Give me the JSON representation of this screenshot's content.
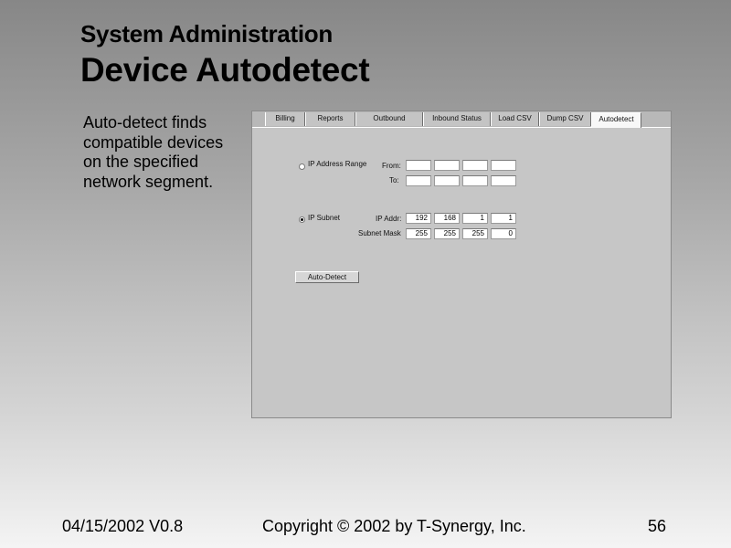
{
  "slide": {
    "subtitle": "System Administration",
    "title": "Device Autodetect",
    "description": "Auto-detect finds compatible devices on the specified network segment."
  },
  "app": {
    "tabs": [
      {
        "label": "Billing",
        "active": false
      },
      {
        "label": "Reports",
        "active": false
      },
      {
        "label": "Outbound",
        "active": false
      },
      {
        "label": "Inbound Status",
        "active": false
      },
      {
        "label": "Load CSV",
        "active": false
      },
      {
        "label": "Dump CSV",
        "active": false
      },
      {
        "label": "Autodetect",
        "active": true
      }
    ],
    "ip_range": {
      "label": "IP Address Range",
      "selected": false,
      "from_label": "From:",
      "to_label": "To:",
      "from": [
        "",
        "",
        "",
        ""
      ],
      "to": [
        "",
        "",
        "",
        ""
      ]
    },
    "ip_subnet": {
      "label": "IP Subnet",
      "selected": true,
      "ip_addr_label": "IP Addr:",
      "subnet_mask_label": "Subnet Mask",
      "ip_addr": [
        "192",
        "168",
        "1",
        "1"
      ],
      "subnet_mask": [
        "255",
        "255",
        "255",
        "0"
      ]
    },
    "autodetect_button": "Auto-Detect"
  },
  "footer": {
    "date_version": "04/15/2002 V0.8",
    "copyright": "Copyright © 2002 by T-Synergy, Inc.",
    "page_number": "56"
  }
}
